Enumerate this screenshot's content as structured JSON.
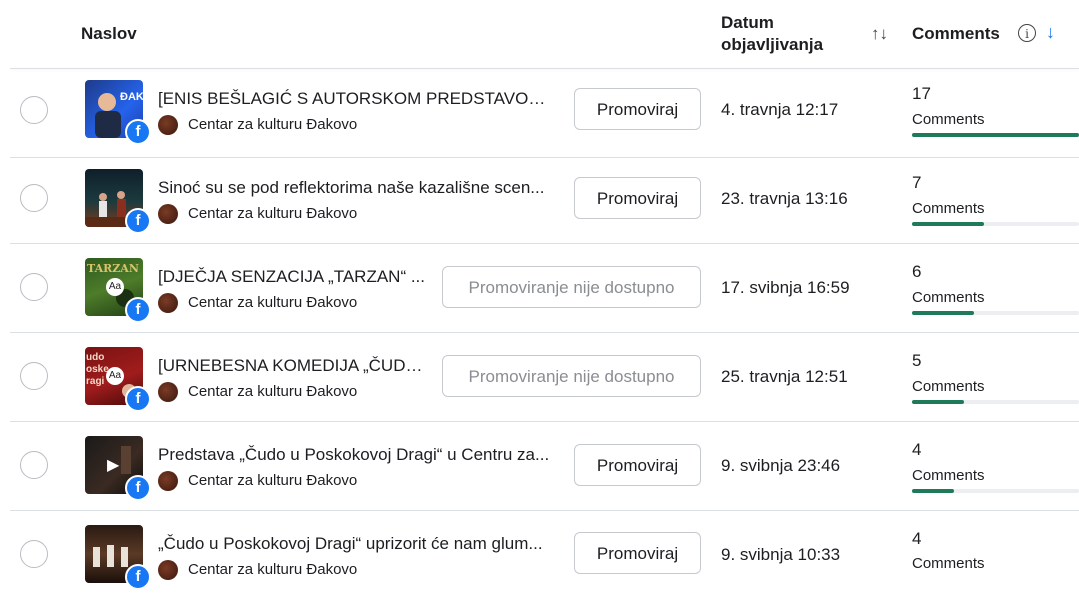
{
  "header": {
    "title_col": "Naslov",
    "date_col": "Datum objavljivanja",
    "sort_icon": "↑↓",
    "comments_col": "Comments",
    "info_icon": "i",
    "sort_desc_icon": "↓"
  },
  "page_name": "Centar za kulturu Đakovo",
  "comments_label": "Comments",
  "rows": [
    {
      "title": "[ENIS BEŠLAGIĆ S AUTORSKOM PREDSTAVOM „...",
      "button": "Promoviraj",
      "available": true,
      "date": "4. travnja 12:17",
      "comments": "17",
      "fill": 1.0
    },
    {
      "title": "Sinoć su se pod reflektorima naše kazališne scen...",
      "button": "Promoviraj",
      "available": true,
      "date": "23. travnja 13:16",
      "comments": "7",
      "fill": 0.43
    },
    {
      "title": "[DJEČJA SENZACIJA „TARZAN“ ...",
      "button": "Promoviranje nije dostupno",
      "available": false,
      "date": "17. svibnja 16:59",
      "comments": "6",
      "fill": 0.37
    },
    {
      "title": "[URNEBESNA KOMEDIJA „ČUDO...",
      "button": "Promoviranje nije dostupno",
      "available": false,
      "date": "25. travnja 12:51",
      "comments": "5",
      "fill": 0.31
    },
    {
      "title": "Predstava „Čudo u Poskokovoj Dragi“ u Centru za...",
      "button": "Promoviraj",
      "available": true,
      "date": "9. svibnja 23:46",
      "comments": "4",
      "fill": 0.25
    },
    {
      "title": "„Čudo u Poskokovoj Dragi“ uprizorit će nam glum...",
      "button": "Promoviraj",
      "available": true,
      "date": "9. svibnja 10:33",
      "comments": "4",
      "fill": 0.25
    }
  ],
  "thumb_overlays": {
    "row1": "ĐAKOV",
    "row3": "TARZAN",
    "row3_badge": "Aa",
    "row4": "udo\noske\nDragi",
    "row4_badge": "Aa",
    "row5_play": "▶"
  },
  "fb_glyph": "f"
}
